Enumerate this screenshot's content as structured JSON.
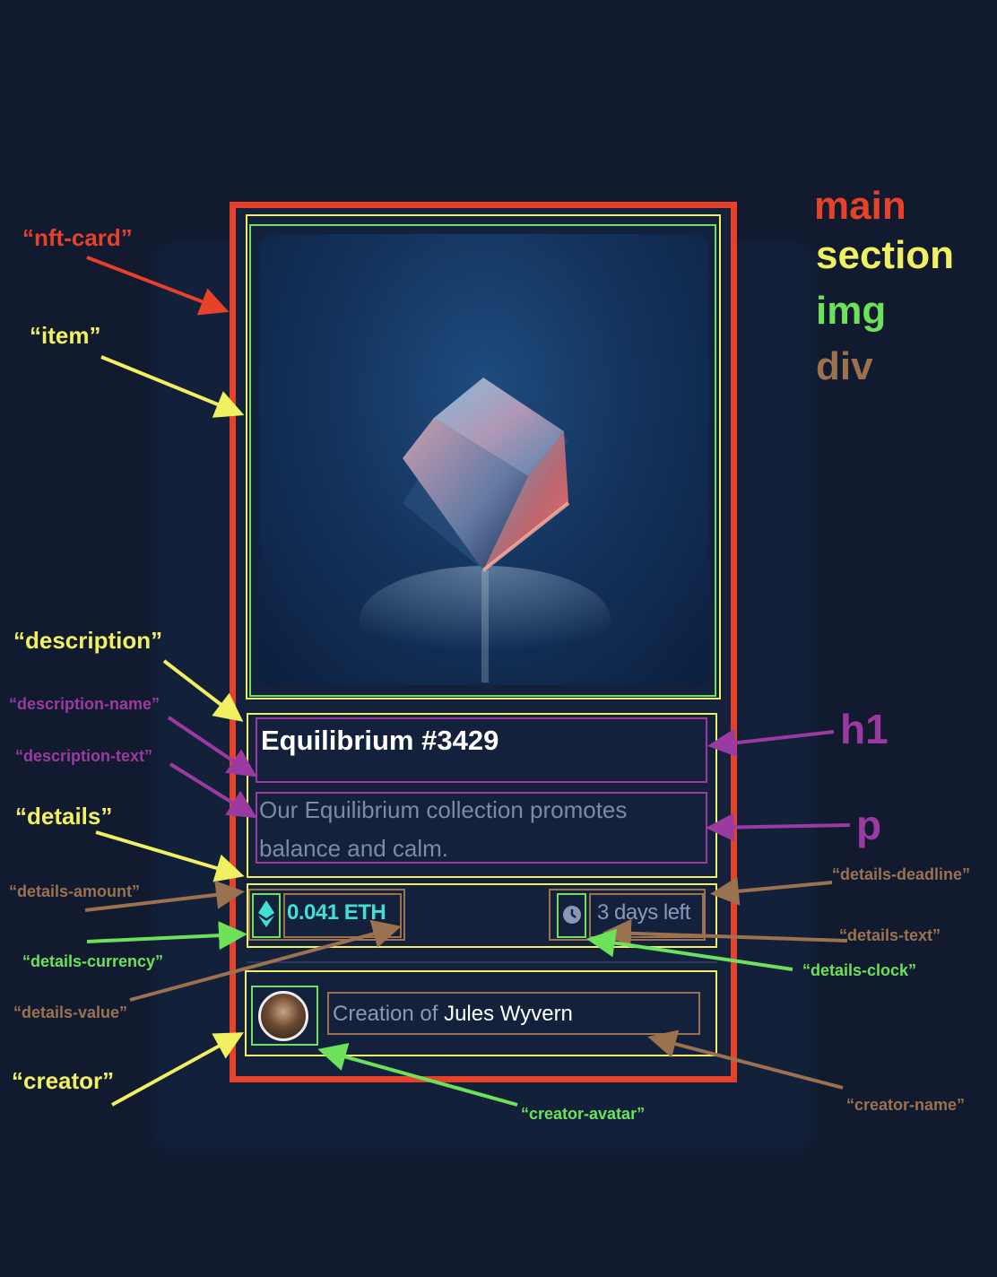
{
  "card": {
    "title": "Equilibrium #3429",
    "description": "Our Equilibrium collection promotes balance and calm.",
    "price": "0.041 ETH",
    "deadline": "3 days left",
    "creator_prefix": "Creation of ",
    "creator_name": "Jules Wyvern"
  },
  "legend": {
    "main": "main",
    "section": "section",
    "img": "img",
    "div": "div",
    "colors": {
      "main": "#e8412a",
      "section": "#f0f060",
      "img": "#6be25a",
      "div": "#9a7250",
      "element_tag": "#9b3aa0"
    }
  },
  "labels": {
    "nft_card": "“nft-card”",
    "item": "“item”",
    "description": "“description”",
    "description_name": "“description-name”",
    "description_text": "“description-text”",
    "details": "“details”",
    "details_amount": "“details-amount”",
    "details_currency": "“details-currency”",
    "details_value": "“details-value”",
    "creator": "“creator”",
    "creator_avatar": "“creator-avatar”",
    "creator_name": "“creator-name”",
    "details_deadline": "“details-deadline”",
    "details_text": "“details-text”",
    "details_clock": "“details-clock”",
    "h1": "h1",
    "p": "p"
  }
}
